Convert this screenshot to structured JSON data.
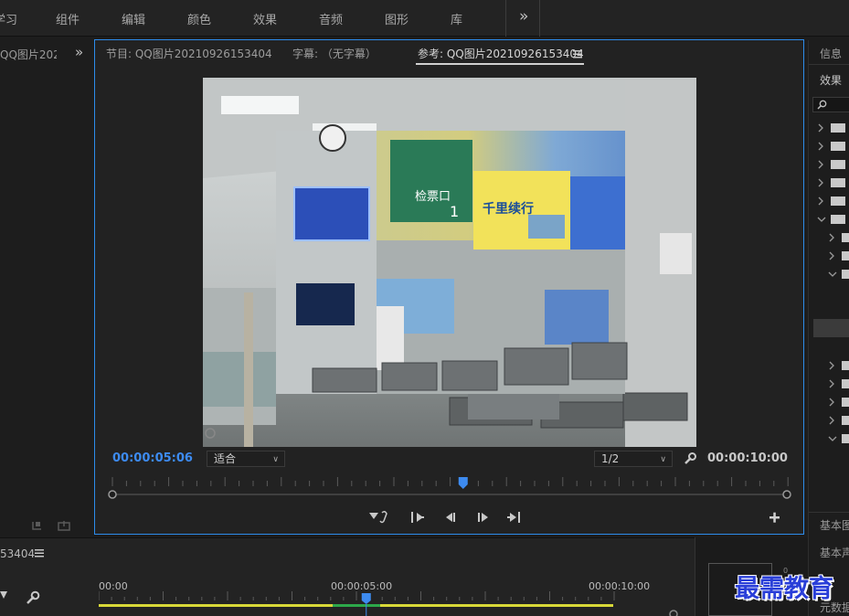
{
  "workspaces": [
    "学习",
    "组件",
    "编辑",
    "颜色",
    "效果",
    "音频",
    "图形",
    "库"
  ],
  "overflow_label": "»",
  "left_panel": {
    "tab_label": "QQ图片202"
  },
  "monitor": {
    "tabs": [
      {
        "label": "节目: QQ图片20210926153404"
      },
      {
        "label": "字幕: （无字幕）"
      },
      {
        "label": "参考: QQ图片20210926153404"
      }
    ],
    "current_time": "00:00:05:06",
    "zoom": "适合",
    "resolution": "1/2",
    "duration": "00:00:10:00",
    "playhead_fraction": 0.52
  },
  "right_panel": {
    "info_label": "信息",
    "effects_label": "效果",
    "bottom_labels": [
      "基本图",
      "基本声",
      "元数据"
    ]
  },
  "timeline": {
    "sequence_label": "53404",
    "ruler": [
      "00:00",
      "00:00:05:00",
      "00:00:10:00"
    ],
    "playhead_fraction": 0.52
  },
  "watermark": "最需教育",
  "colors": {
    "accent": "#2d8ceb",
    "timecode_blue": "#3d8bf0",
    "workarea": "#d8d838"
  }
}
